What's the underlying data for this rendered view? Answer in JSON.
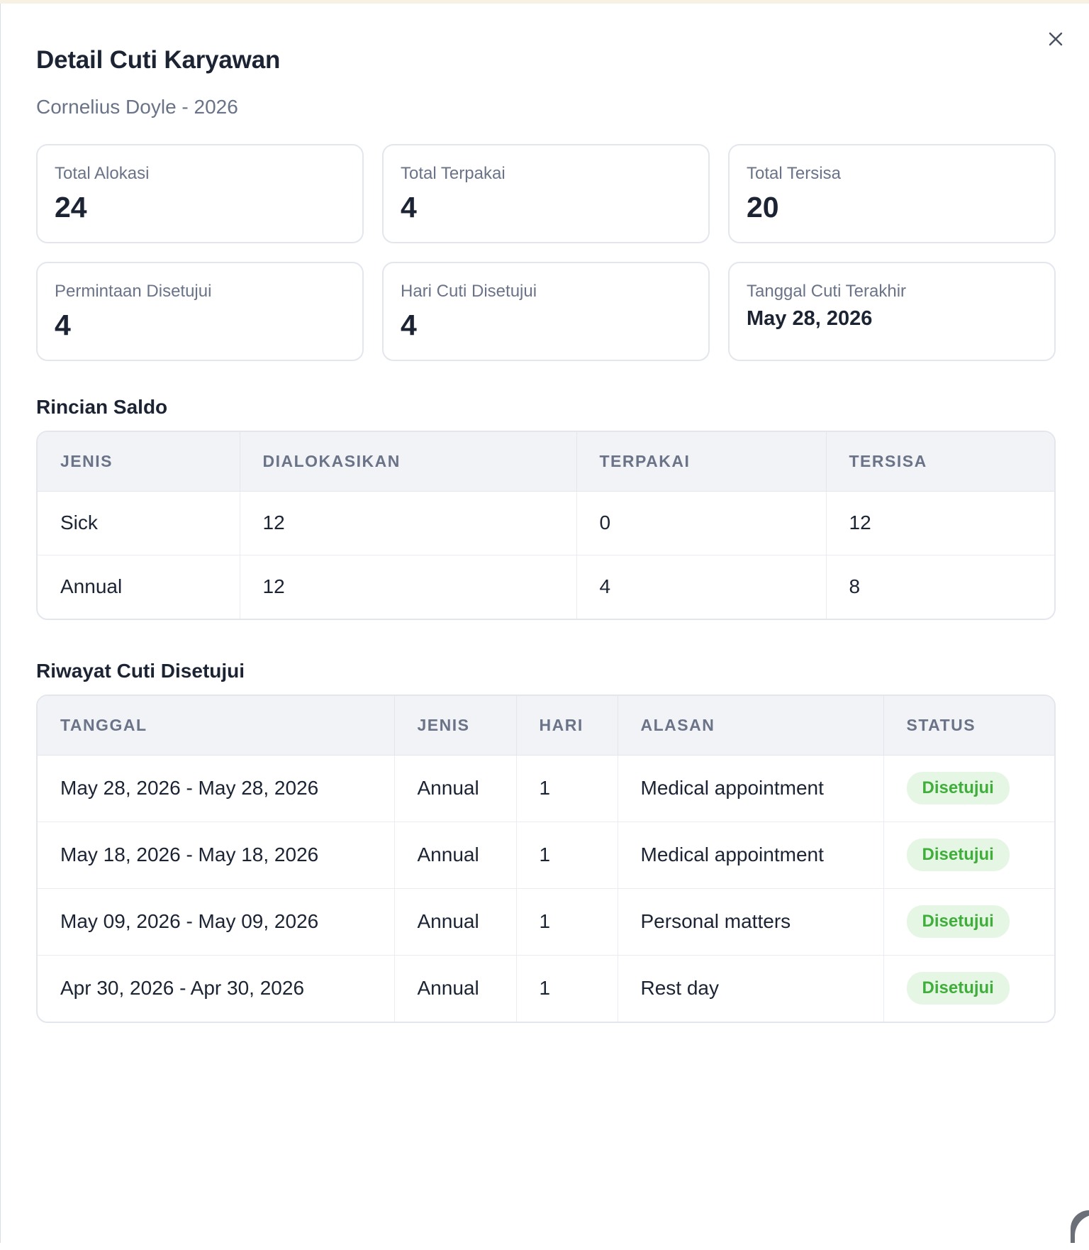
{
  "modal": {
    "title": "Detail Cuti Karyawan",
    "subtitle": "Cornelius Doyle - 2026"
  },
  "stats": [
    {
      "label": "Total Alokasi",
      "value": "24"
    },
    {
      "label": "Total Terpakai",
      "value": "4"
    },
    {
      "label": "Total Tersisa",
      "value": "20"
    },
    {
      "label": "Permintaan Disetujui",
      "value": "4"
    },
    {
      "label": "Hari Cuti Disetujui",
      "value": "4"
    },
    {
      "label": "Tanggal Cuti Terakhir",
      "value": "May 28, 2026"
    }
  ],
  "saldo": {
    "title": "Rincian Saldo",
    "headers": [
      "JENIS",
      "DIALOKASIKAN",
      "TERPAKAI",
      "TERSISA"
    ],
    "rows": [
      [
        "Sick",
        "12",
        "0",
        "12"
      ],
      [
        "Annual",
        "12",
        "4",
        "8"
      ]
    ]
  },
  "riwayat": {
    "title": "Riwayat Cuti Disetujui",
    "headers": [
      "TANGGAL",
      "JENIS",
      "HARI",
      "ALASAN",
      "STATUS"
    ],
    "rows": [
      [
        "May 28, 2026 - May 28, 2026",
        "Annual",
        "1",
        "Medical appointment",
        "Disetujui"
      ],
      [
        "May 18, 2026 - May 18, 2026",
        "Annual",
        "1",
        "Medical appointment",
        "Disetujui"
      ],
      [
        "May 09, 2026 - May 09, 2026",
        "Annual",
        "1",
        "Personal matters",
        "Disetujui"
      ],
      [
        "Apr 30, 2026 - Apr 30, 2026",
        "Annual",
        "1",
        "Rest day",
        "Disetujui"
      ]
    ]
  },
  "icons": {
    "close": "close-icon"
  },
  "colors": {
    "approved_text": "#3fae3a",
    "approved_bg": "#e6f6e4"
  }
}
